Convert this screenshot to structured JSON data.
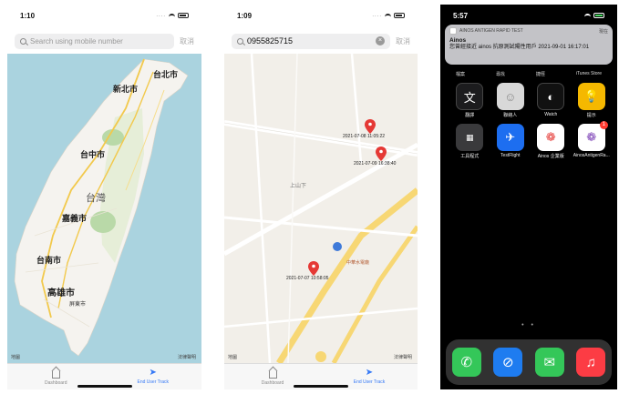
{
  "screen1": {
    "time": "1:10",
    "search_placeholder": "Search using mobile number",
    "cancel_label": "取消",
    "cities": {
      "taipei": "台北市",
      "new_taipei": "新北市",
      "taichung": "台中市",
      "taiwan": "台灣",
      "chiayi": "嘉義市",
      "tainan": "台南市",
      "kaohsiung": "高雄市",
      "pingtung": "屏東市"
    },
    "legal_label": "地圖",
    "legal_right": "法律聲明",
    "tabs": {
      "dashboard": "Dashboard",
      "end_track": "End User Track"
    }
  },
  "screen2": {
    "time": "1:09",
    "search_value": "0955825715",
    "cancel_label": "取消",
    "pins": [
      {
        "label": "2021-07-08 11:05:22"
      },
      {
        "label": "2021-07-09 16:38:40"
      },
      {
        "label": "2021-07-07 10:58:05"
      }
    ],
    "map_labels": {
      "shangshanxia": "上山下",
      "poi": "中華水電廠"
    },
    "legal_label": "地圖",
    "legal_right": "法律聲明",
    "tabs": {
      "dashboard": "Dashboard",
      "end_track": "End User Track"
    }
  },
  "screen3": {
    "time": "5:57",
    "notification": {
      "app": "AINOS ANTIGEN RAPID TEST",
      "when": "現在",
      "title": "Ainos",
      "body": "您曾經接近 ainos 抗原測試陽性用戶 2021-09-01 16:17:01"
    },
    "top_labels": [
      "檔案",
      "尋找",
      "捷徑",
      "iTunes Store"
    ],
    "apps": [
      {
        "label": "翻譯",
        "icon": "translate-icon",
        "color": "#1c1c1e"
      },
      {
        "label": "聯絡人",
        "icon": "contacts-icon",
        "color": "#d8d8d8"
      },
      {
        "label": "Watch",
        "icon": "watch-icon",
        "color": "#111111"
      },
      {
        "label": "提示",
        "icon": "tips-icon",
        "color": "#f5b800"
      },
      {
        "label": "工具程式",
        "icon": "utilities-folder-icon",
        "color": "#3a3a3c"
      },
      {
        "label": "TestFlight",
        "icon": "testflight-icon",
        "color": "#1d6ef0"
      },
      {
        "label": "Ainos 企業版",
        "icon": "ainos-enterprise-icon",
        "color": "#ffffff"
      },
      {
        "label": "AinosAntigenRa...",
        "icon": "ainos-antigen-icon",
        "color": "#ffffff",
        "badge": "1"
      }
    ],
    "page_dots": "• •",
    "dock": [
      {
        "icon": "phone-icon",
        "color": "#34c759"
      },
      {
        "icon": "safari-icon",
        "color": "#1e7cf0"
      },
      {
        "icon": "messages-icon",
        "color": "#34c759"
      },
      {
        "icon": "music-icon",
        "color": "#fc3c44"
      }
    ]
  }
}
